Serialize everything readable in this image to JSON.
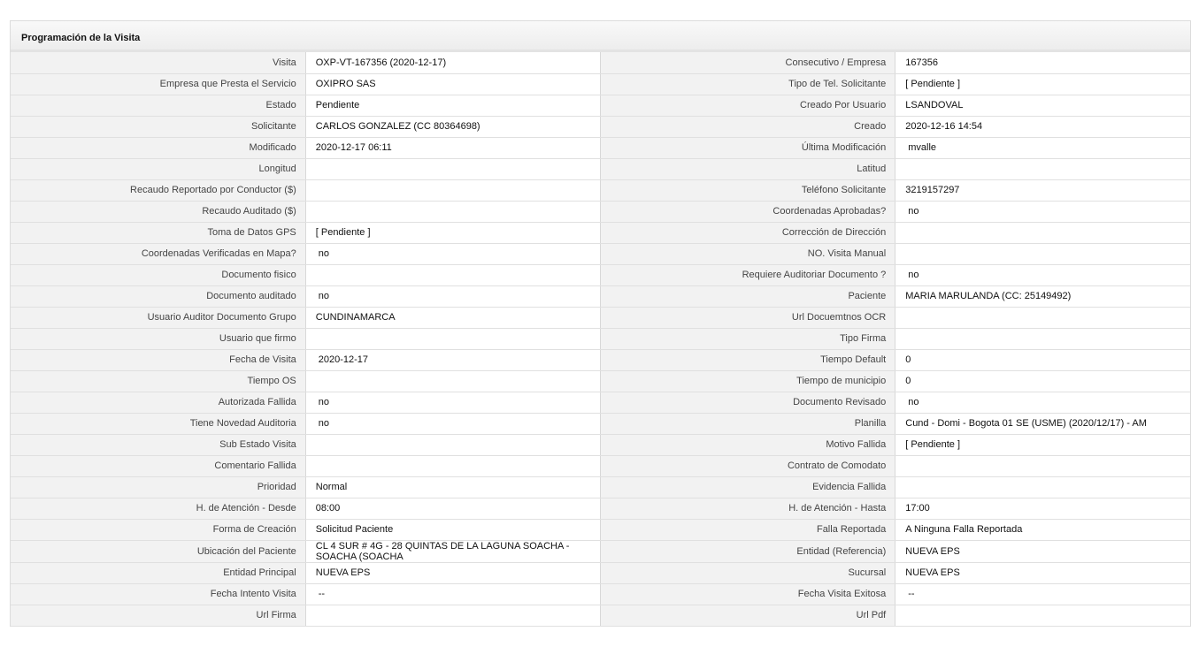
{
  "panel": {
    "title": "Programación de la Visita"
  },
  "rows": [
    {
      "left": {
        "label": "Visita",
        "value": "OXP-VT-167356 (2020-12-17)"
      },
      "right": {
        "label": "Consecutivo / Empresa",
        "value": "167356"
      }
    },
    {
      "left": {
        "label": "Empresa que Presta el Servicio",
        "value": "OXIPRO SAS"
      },
      "right": {
        "label": "Tipo de Tel. Solicitante",
        "value": "[ Pendiente ]"
      }
    },
    {
      "left": {
        "label": "Estado",
        "value": "Pendiente"
      },
      "right": {
        "label": "Creado Por Usuario",
        "value": "LSANDOVAL"
      }
    },
    {
      "left": {
        "label": "Solicitante",
        "value": "CARLOS GONZALEZ (CC 80364698)"
      },
      "right": {
        "label": "Creado",
        "value": "2020-12-16 14:54"
      }
    },
    {
      "left": {
        "label": "Modificado",
        "value": "2020-12-17 06:11"
      },
      "right": {
        "label": "Última Modificación",
        "value": "mvalle"
      }
    },
    {
      "left": {
        "label": "Longitud",
        "value": ""
      },
      "right": {
        "label": "Latitud",
        "value": ""
      }
    },
    {
      "left": {
        "label": "Recaudo Reportado por Conductor ($)",
        "value": ""
      },
      "right": {
        "label": "Teléfono Solicitante",
        "value": "3219157297"
      }
    },
    {
      "left": {
        "label": "Recaudo Auditado ($)",
        "value": ""
      },
      "right": {
        "label": "Coordenadas Aprobadas?",
        "value": "no"
      }
    },
    {
      "left": {
        "label": "Toma de Datos GPS",
        "value": "[ Pendiente ]"
      },
      "right": {
        "label": "Corrección de Dirección",
        "value": ""
      }
    },
    {
      "left": {
        "label": "Coordenadas Verificadas en Mapa?",
        "value": "no"
      },
      "right": {
        "label": "NO. Visita Manual",
        "value": ""
      }
    },
    {
      "left": {
        "label": "Documento fisico",
        "value": ""
      },
      "right": {
        "label": "Requiere Auditoriar Documento ?",
        "value": "no"
      }
    },
    {
      "left": {
        "label": "Documento auditado",
        "value": "no"
      },
      "right": {
        "label": "Paciente",
        "value": "MARIA MARULANDA (CC: 25149492)"
      }
    },
    {
      "left": {
        "label": "Usuario Auditor Documento Grupo",
        "value": "CUNDINAMARCA"
      },
      "right": {
        "label": "Url Docuemtnos OCR",
        "value": ""
      }
    },
    {
      "left": {
        "label": "Usuario que firmo",
        "value": ""
      },
      "right": {
        "label": "Tipo Firma",
        "value": ""
      }
    },
    {
      "left": {
        "label": "Fecha de Visita",
        "value": "2020-12-17"
      },
      "right": {
        "label": "Tiempo Default",
        "value": "0"
      }
    },
    {
      "left": {
        "label": "Tiempo OS",
        "value": ""
      },
      "right": {
        "label": "Tiempo de municipio",
        "value": "0"
      }
    },
    {
      "left": {
        "label": "Autorizada Fallida",
        "value": "no"
      },
      "right": {
        "label": "Documento Revisado",
        "value": "no"
      }
    },
    {
      "left": {
        "label": "Tiene Novedad Auditoria",
        "value": "no"
      },
      "right": {
        "label": "Planilla",
        "value": "Cund - Domi - Bogota 01 SE (USME) (2020/12/17) - AM"
      }
    },
    {
      "left": {
        "label": "Sub Estado Visita",
        "value": ""
      },
      "right": {
        "label": "Motivo Fallida",
        "value": "[ Pendiente ]"
      }
    },
    {
      "left": {
        "label": "Comentario Fallida",
        "value": ""
      },
      "right": {
        "label": "Contrato de Comodato",
        "value": ""
      }
    },
    {
      "left": {
        "label": "Prioridad",
        "value": "Normal"
      },
      "right": {
        "label": "Evidencia Fallida",
        "value": ""
      }
    },
    {
      "left": {
        "label": "H. de Atención - Desde",
        "value": "08:00"
      },
      "right": {
        "label": "H. de Atención - Hasta",
        "value": "17:00"
      }
    },
    {
      "left": {
        "label": "Forma de Creación",
        "value": "Solicitud Paciente"
      },
      "right": {
        "label": "Falla Reportada",
        "value": "A Ninguna Falla Reportada"
      }
    },
    {
      "left": {
        "label": "Ubicación del Paciente",
        "value": "CL 4 SUR # 4G - 28 QUINTAS DE LA LAGUNA SOACHA - SOACHA (SOACHA"
      },
      "right": {
        "label": "Entidad (Referencia)",
        "value": "NUEVA EPS"
      }
    },
    {
      "left": {
        "label": "Entidad Principal",
        "value": "NUEVA EPS"
      },
      "right": {
        "label": "Sucursal",
        "value": "NUEVA EPS"
      }
    },
    {
      "left": {
        "label": "Fecha Intento Visita",
        "value": "--"
      },
      "right": {
        "label": "Fecha Visita Exitosa",
        "value": "--"
      }
    },
    {
      "left": {
        "label": "Url Firma",
        "value": ""
      },
      "right": {
        "label": "Url Pdf",
        "value": ""
      }
    }
  ]
}
